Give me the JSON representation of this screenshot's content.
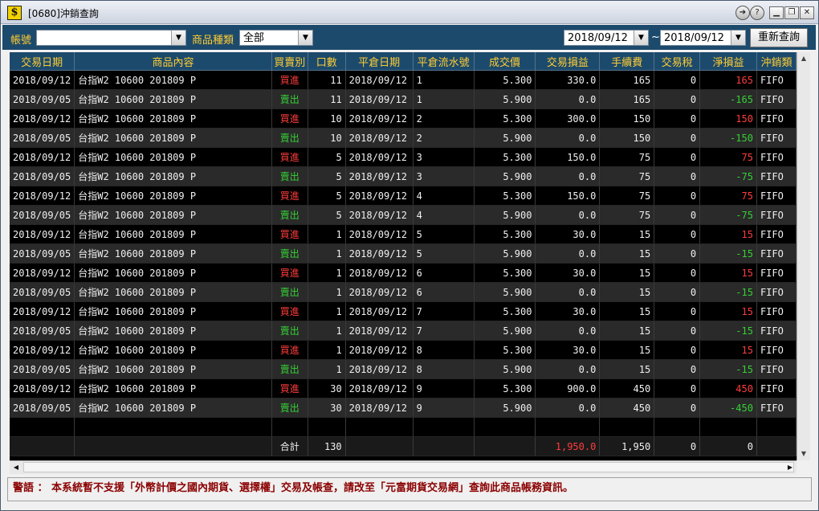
{
  "window": {
    "title": "[0680]沖銷查詢"
  },
  "toolbar": {
    "account_label": "帳號",
    "account_value": "",
    "product_type_label": "商品種類",
    "product_type_value": "全部",
    "date_from": "2018/09/12",
    "date_sep": "~",
    "date_to": "2018/09/12",
    "requery_label": "重新查詢"
  },
  "table": {
    "headers": [
      "交易日期",
      "商品內容",
      "買賣別",
      "口數",
      "平倉日期",
      "平倉流水號",
      "成交價",
      "交易損益",
      "手續費",
      "交易稅",
      "淨損益",
      "沖銷類"
    ],
    "rows": [
      {
        "date": "2018/09/12",
        "product": "台指W2 10600 201809 P",
        "side": "買進",
        "qty": "11",
        "close_date": "2018/09/12",
        "seq": "1",
        "price": "5.300",
        "pnl": "330.0",
        "fee": "165",
        "tax": "0",
        "net": "165",
        "method": "FIFO"
      },
      {
        "date": "2018/09/05",
        "product": "台指W2 10600 201809 P",
        "side": "賣出",
        "qty": "11",
        "close_date": "2018/09/12",
        "seq": "1",
        "price": "5.900",
        "pnl": "0.0",
        "fee": "165",
        "tax": "0",
        "net": "-165",
        "method": "FIFO"
      },
      {
        "date": "2018/09/12",
        "product": "台指W2 10600 201809 P",
        "side": "買進",
        "qty": "10",
        "close_date": "2018/09/12",
        "seq": "2",
        "price": "5.300",
        "pnl": "300.0",
        "fee": "150",
        "tax": "0",
        "net": "150",
        "method": "FIFO"
      },
      {
        "date": "2018/09/05",
        "product": "台指W2 10600 201809 P",
        "side": "賣出",
        "qty": "10",
        "close_date": "2018/09/12",
        "seq": "2",
        "price": "5.900",
        "pnl": "0.0",
        "fee": "150",
        "tax": "0",
        "net": "-150",
        "method": "FIFO"
      },
      {
        "date": "2018/09/12",
        "product": "台指W2 10600 201809 P",
        "side": "買進",
        "qty": "5",
        "close_date": "2018/09/12",
        "seq": "3",
        "price": "5.300",
        "pnl": "150.0",
        "fee": "75",
        "tax": "0",
        "net": "75",
        "method": "FIFO"
      },
      {
        "date": "2018/09/05",
        "product": "台指W2 10600 201809 P",
        "side": "賣出",
        "qty": "5",
        "close_date": "2018/09/12",
        "seq": "3",
        "price": "5.900",
        "pnl": "0.0",
        "fee": "75",
        "tax": "0",
        "net": "-75",
        "method": "FIFO"
      },
      {
        "date": "2018/09/12",
        "product": "台指W2 10600 201809 P",
        "side": "買進",
        "qty": "5",
        "close_date": "2018/09/12",
        "seq": "4",
        "price": "5.300",
        "pnl": "150.0",
        "fee": "75",
        "tax": "0",
        "net": "75",
        "method": "FIFO"
      },
      {
        "date": "2018/09/05",
        "product": "台指W2 10600 201809 P",
        "side": "賣出",
        "qty": "5",
        "close_date": "2018/09/12",
        "seq": "4",
        "price": "5.900",
        "pnl": "0.0",
        "fee": "75",
        "tax": "0",
        "net": "-75",
        "method": "FIFO"
      },
      {
        "date": "2018/09/12",
        "product": "台指W2 10600 201809 P",
        "side": "買進",
        "qty": "1",
        "close_date": "2018/09/12",
        "seq": "5",
        "price": "5.300",
        "pnl": "30.0",
        "fee": "15",
        "tax": "0",
        "net": "15",
        "method": "FIFO"
      },
      {
        "date": "2018/09/05",
        "product": "台指W2 10600 201809 P",
        "side": "賣出",
        "qty": "1",
        "close_date": "2018/09/12",
        "seq": "5",
        "price": "5.900",
        "pnl": "0.0",
        "fee": "15",
        "tax": "0",
        "net": "-15",
        "method": "FIFO"
      },
      {
        "date": "2018/09/12",
        "product": "台指W2 10600 201809 P",
        "side": "買進",
        "qty": "1",
        "close_date": "2018/09/12",
        "seq": "6",
        "price": "5.300",
        "pnl": "30.0",
        "fee": "15",
        "tax": "0",
        "net": "15",
        "method": "FIFO"
      },
      {
        "date": "2018/09/05",
        "product": "台指W2 10600 201809 P",
        "side": "賣出",
        "qty": "1",
        "close_date": "2018/09/12",
        "seq": "6",
        "price": "5.900",
        "pnl": "0.0",
        "fee": "15",
        "tax": "0",
        "net": "-15",
        "method": "FIFO"
      },
      {
        "date": "2018/09/12",
        "product": "台指W2 10600 201809 P",
        "side": "買進",
        "qty": "1",
        "close_date": "2018/09/12",
        "seq": "7",
        "price": "5.300",
        "pnl": "30.0",
        "fee": "15",
        "tax": "0",
        "net": "15",
        "method": "FIFO"
      },
      {
        "date": "2018/09/05",
        "product": "台指W2 10600 201809 P",
        "side": "賣出",
        "qty": "1",
        "close_date": "2018/09/12",
        "seq": "7",
        "price": "5.900",
        "pnl": "0.0",
        "fee": "15",
        "tax": "0",
        "net": "-15",
        "method": "FIFO"
      },
      {
        "date": "2018/09/12",
        "product": "台指W2 10600 201809 P",
        "side": "買進",
        "qty": "1",
        "close_date": "2018/09/12",
        "seq": "8",
        "price": "5.300",
        "pnl": "30.0",
        "fee": "15",
        "tax": "0",
        "net": "15",
        "method": "FIFO"
      },
      {
        "date": "2018/09/05",
        "product": "台指W2 10600 201809 P",
        "side": "賣出",
        "qty": "1",
        "close_date": "2018/09/12",
        "seq": "8",
        "price": "5.900",
        "pnl": "0.0",
        "fee": "15",
        "tax": "0",
        "net": "-15",
        "method": "FIFO"
      },
      {
        "date": "2018/09/12",
        "product": "台指W2 10600 201809 P",
        "side": "買進",
        "qty": "30",
        "close_date": "2018/09/12",
        "seq": "9",
        "price": "5.300",
        "pnl": "900.0",
        "fee": "450",
        "tax": "0",
        "net": "450",
        "method": "FIFO"
      },
      {
        "date": "2018/09/05",
        "product": "台指W2 10600 201809 P",
        "side": "賣出",
        "qty": "30",
        "close_date": "2018/09/12",
        "seq": "9",
        "price": "5.900",
        "pnl": "0.0",
        "fee": "450",
        "tax": "0",
        "net": "-450",
        "method": "FIFO"
      }
    ],
    "total": {
      "label": "合計",
      "qty": "130",
      "pnl": "1,950.0",
      "fee": "1,950",
      "tax": "0",
      "net": "0"
    }
  },
  "status": {
    "warning": "警語 ： 本系統暫不支援「外幣計價之國內期貨、選擇權」交易及帳查，請改至「元富期貨交易網」查詢此商品帳務資訊。"
  },
  "colors": {
    "header_bg": "#1c4a6c",
    "header_text": "#ffcc33",
    "buy": "#ff3c3c",
    "sell": "#35d035",
    "warning": "#8b0000"
  },
  "icons": {
    "app": "dollar-app-icon",
    "controls": [
      "nav-icon",
      "help-icon",
      "minimize-icon",
      "maximize-icon",
      "close-icon"
    ]
  }
}
